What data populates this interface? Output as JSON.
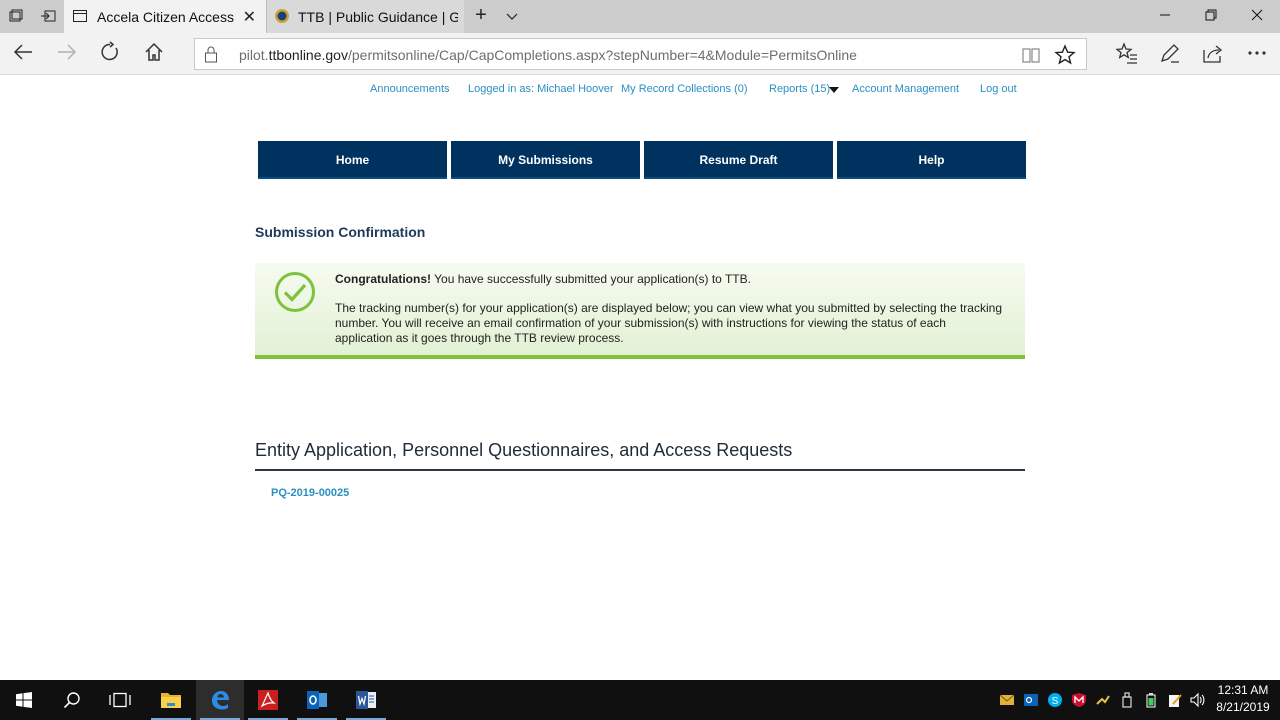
{
  "browser": {
    "tabs": [
      {
        "title": "Accela Citizen Access",
        "active": true
      },
      {
        "title": "TTB | Public Guidance | Guic",
        "active": false
      }
    ],
    "new_tab_glyph": "+",
    "close_glyph": "✕",
    "url_host_prefix": "pilot.",
    "url_host": "ttbonline.gov",
    "url_path": "/permitsonline/Cap/CapCompletions.aspx?stepNumber=4&Module=PermitsOnline",
    "icons": [
      "set-aside-icon",
      "back-icon",
      "forward-icon",
      "refresh-icon",
      "home-icon",
      "reading-view-icon",
      "favorite-star-icon",
      "favorites-hub-icon",
      "pen-icon",
      "share-icon",
      "more-icon"
    ]
  },
  "top_links": {
    "announcements": "Announcements",
    "logged_in": "Logged in as: Michael Hoover",
    "collections": "My Record Collections (0)",
    "reports": "Reports (15)",
    "account": "Account Management",
    "logout": "Log out"
  },
  "main_nav": {
    "home": "Home",
    "submissions": "My Submissions",
    "resume": "Resume Draft",
    "help": "Help"
  },
  "content": {
    "heading": "Submission Confirmation",
    "congrats_bold": "Congratulations!",
    "congrats_rest": " You have successfully submitted your application(s) to TTB.",
    "tracking_text": "The tracking number(s) for your application(s) are displayed below; you can view what you submitted by selecting the tracking number. You will receive an email confirmation of your submission(s) with instructions for viewing the status of each application as it goes through the TTB review process.",
    "section_title": "Entity Application, Personnel Questionnaires, and Access Requests",
    "record_id": "PQ-2019-00025"
  },
  "taskbar": {
    "time": "12:31 AM",
    "date": "8/21/2019"
  },
  "colors": {
    "nav_blue": "#00325f",
    "link_blue": "#2a8fc2",
    "success_green": "#7dc13d"
  }
}
